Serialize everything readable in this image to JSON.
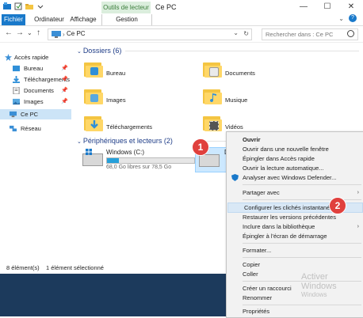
{
  "window": {
    "title": "Ce PC",
    "context_tab_label": "Outils de lecteur",
    "controls": {
      "minimize": "—",
      "maximize": "☐",
      "close": "✕"
    }
  },
  "ribbon": {
    "tabs": [
      {
        "label": "Fichier",
        "active": true
      },
      {
        "label": "Ordinateur"
      },
      {
        "label": "Affichage"
      },
      {
        "label": "Gestion"
      }
    ],
    "expand": "⌄",
    "help": "?"
  },
  "nav": {
    "back": "←",
    "forward": "→",
    "recent": "⌄",
    "up": "↑",
    "address": "Ce PC",
    "address_dropdown": "⌄",
    "refresh": "↻",
    "search_placeholder": "Rechercher dans : Ce PC"
  },
  "sidebar": {
    "items": [
      {
        "label": "Accès rapide",
        "icon": "star-icon",
        "pinned": false
      },
      {
        "label": "Bureau",
        "icon": "desktop-folder-icon",
        "pinned": true
      },
      {
        "label": "Téléchargements",
        "icon": "downloads-folder-icon",
        "pinned": true
      },
      {
        "label": "Documents",
        "icon": "documents-folder-icon",
        "pinned": true
      },
      {
        "label": "Images",
        "icon": "pictures-folder-icon",
        "pinned": true
      },
      {
        "label": "Ce PC",
        "icon": "computer-icon",
        "selected": true
      },
      {
        "label": "Réseau",
        "icon": "network-icon"
      }
    ],
    "pin_glyph": "📌"
  },
  "content": {
    "folders_header": "Dossiers (6)",
    "folders": [
      {
        "label": "Bureau",
        "deco": "#2f8fd8"
      },
      {
        "label": "Documents",
        "deco": "#eaeaea"
      },
      {
        "label": "Images",
        "deco": "#58a8e0"
      },
      {
        "label": "Musique",
        "deco": "#2f8fd8"
      },
      {
        "label": "Téléchargements",
        "deco": "#2f8fd8"
      },
      {
        "label": "Vidéos",
        "deco": "#555555"
      }
    ],
    "drives_header": "Périphériques et lecteurs (2)",
    "drive_c": {
      "name": "Windows (C:)",
      "free": "68,0 Go libres sur 78,5 Go",
      "used_fraction": 0.134
    },
    "drive_d": {
      "label": "D"
    }
  },
  "status": {
    "count": "8 élément(s)",
    "selected": "1 élément sélectionné"
  },
  "callouts": [
    "1",
    "2"
  ],
  "context_menu": {
    "items": [
      {
        "label": "Ouvrir",
        "bold": true
      },
      {
        "label": "Ouvrir dans une nouvelle fenêtre"
      },
      {
        "label": "Épingler dans Accès rapide"
      },
      {
        "label": "Ouvrir la lecture automatique..."
      },
      {
        "label": "Analyser avec Windows Defender...",
        "icon": "defender-icon"
      },
      {
        "label": "Partager avec",
        "submenu": true
      },
      {
        "label": "Configurer les clichés instantanés...",
        "highlighted": true
      },
      {
        "label": "Restaurer les versions précédentes"
      },
      {
        "label": "Inclure dans la bibliothèque",
        "submenu": true
      },
      {
        "label": "Épingler à l'écran de démarrage"
      },
      {
        "label": "Formater..."
      },
      {
        "label": "Copier"
      },
      {
        "label": "Coller"
      },
      {
        "label": "Créer un raccourci"
      },
      {
        "label": "Renommer"
      },
      {
        "label": "Propriétés"
      }
    ],
    "submenu_arrow": "›"
  },
  "watermark": {
    "line1": "Activer Windows",
    "line2": "Windows"
  },
  "colors": {
    "accent": "#1979ca",
    "callout": "#e0403d",
    "highlight": "#d9e8f6"
  }
}
